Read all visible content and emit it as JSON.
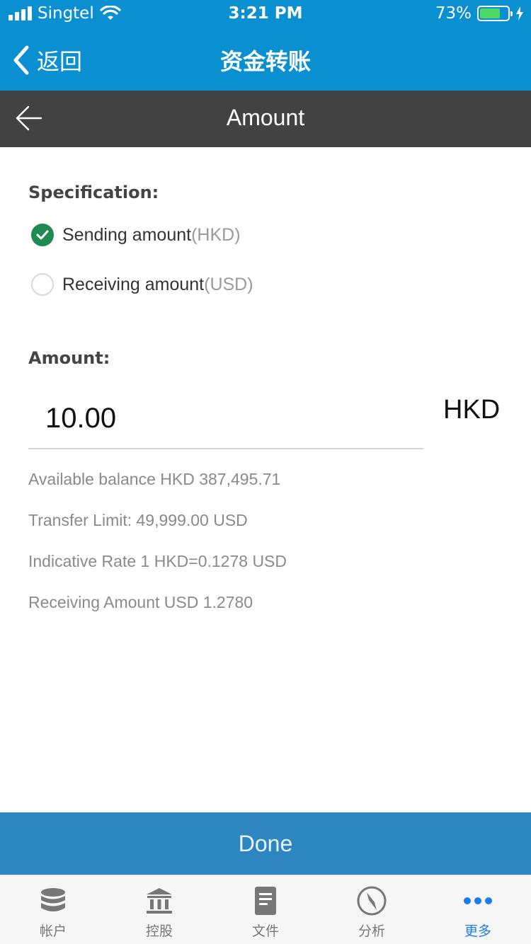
{
  "status_bar": {
    "carrier": "Singtel",
    "time": "3:21 PM",
    "battery": "73%",
    "battery_level": 0.73
  },
  "nav": {
    "back_label": "返回",
    "title": "资金转账"
  },
  "sub_header": {
    "title": "Amount"
  },
  "specification": {
    "label": "Specification:",
    "options": [
      {
        "text": "Sending amount",
        "unit": "(HKD)",
        "selected": true
      },
      {
        "text": "Receiving amount",
        "unit": "(USD)",
        "selected": false
      }
    ]
  },
  "amount": {
    "label": "Amount:",
    "value": "10.00",
    "currency": "HKD"
  },
  "info": {
    "balance": "Available balance HKD 387,495.71",
    "limit": "Transfer Limit: 49,999.00 USD",
    "rate": "Indicative Rate 1 HKD=0.1278 USD",
    "receiving": "Receiving Amount USD 1.2780"
  },
  "done_label": "Done",
  "tabs": [
    {
      "label": "帐户",
      "icon": "database-icon",
      "active": false
    },
    {
      "label": "控股",
      "icon": "bank-icon",
      "active": false
    },
    {
      "label": "文件",
      "icon": "document-icon",
      "active": false
    },
    {
      "label": "分析",
      "icon": "compass-icon",
      "active": false
    },
    {
      "label": "更多",
      "icon": "more-icon",
      "active": true
    }
  ],
  "colors": {
    "primary": "#0a8fd1",
    "header_dark": "#424242",
    "check_green": "#1f8a52",
    "done_button": "#2e86c1",
    "tab_active": "#1e7ee8"
  }
}
